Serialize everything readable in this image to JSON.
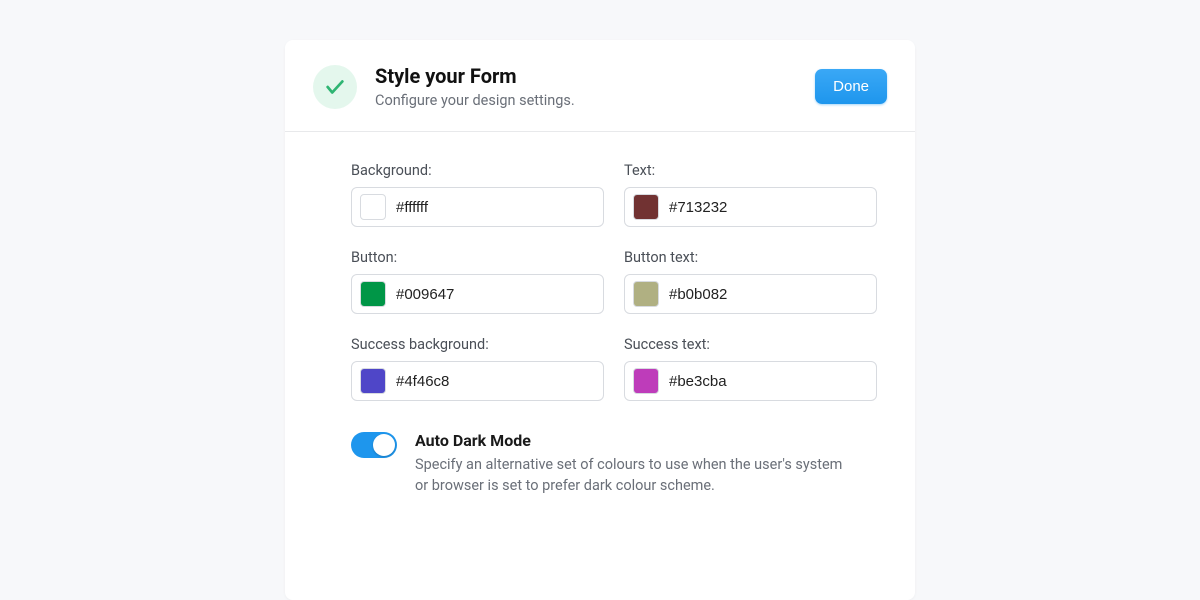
{
  "header": {
    "title": "Style your Form",
    "subtitle": "Configure your design settings.",
    "done_label": "Done"
  },
  "fields": {
    "background": {
      "label": "Background:",
      "value": "#ffffff",
      "swatch": "#ffffff"
    },
    "text": {
      "label": "Text:",
      "value": "#713232",
      "swatch": "#713232"
    },
    "button": {
      "label": "Button:",
      "value": "#009647",
      "swatch": "#009647"
    },
    "button_text": {
      "label": "Button text:",
      "value": "#b0b082",
      "swatch": "#b0b082"
    },
    "success_background": {
      "label": "Success background:",
      "value": "#4f46c8",
      "swatch": "#4f46c8"
    },
    "success_text": {
      "label": "Success text:",
      "value": "#be3cba",
      "swatch": "#be3cba"
    }
  },
  "toggle": {
    "title": "Auto Dark Mode",
    "description": "Specify an alternative set of colours to use when the user's system or browser is set to prefer dark colour scheme.",
    "on": true
  }
}
